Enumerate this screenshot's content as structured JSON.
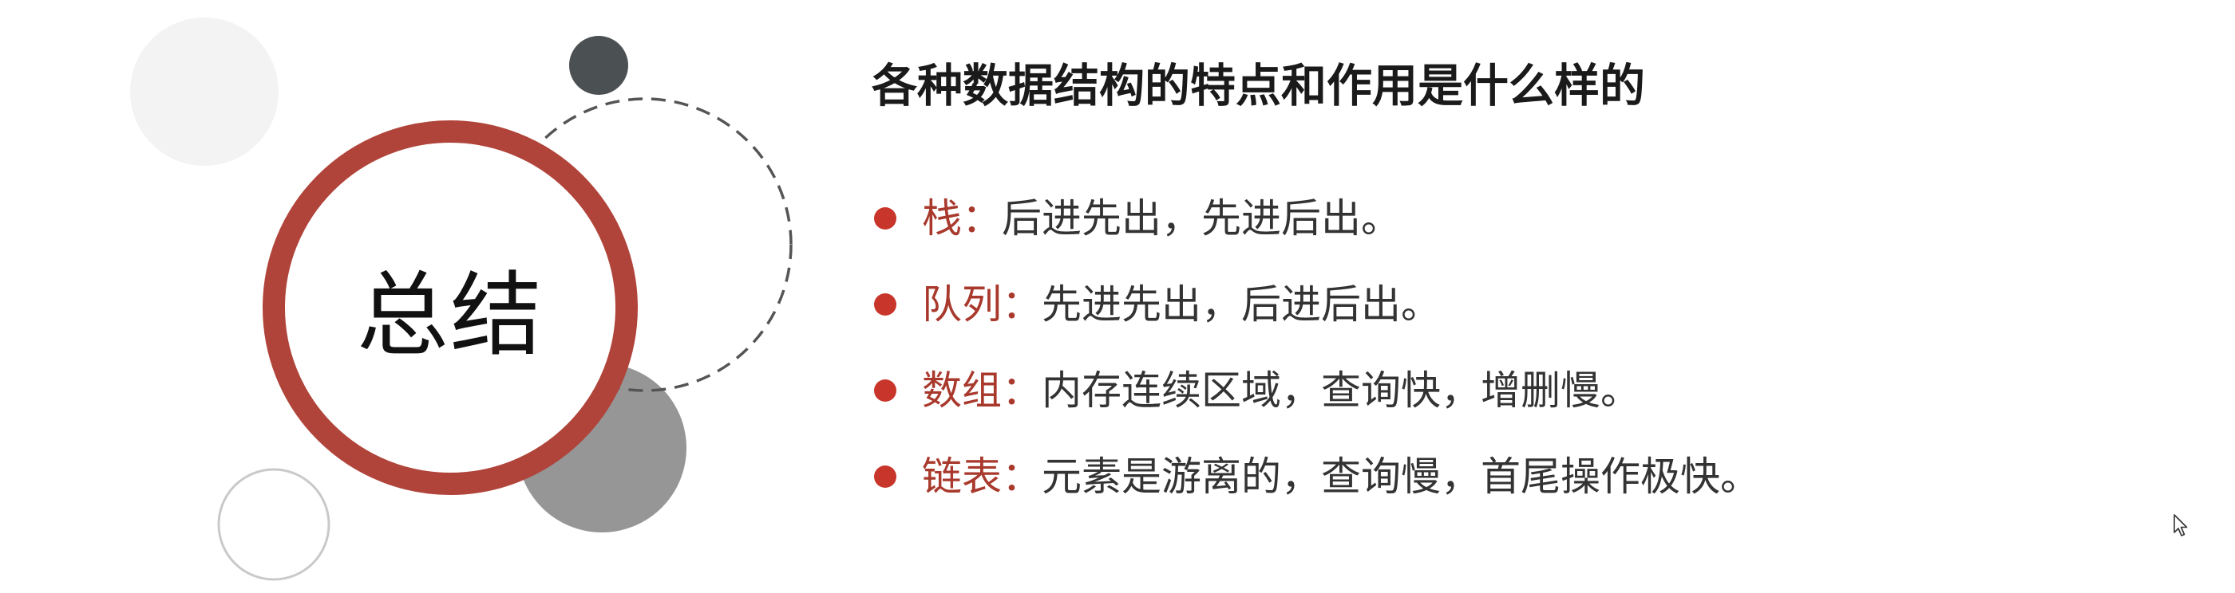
{
  "slide": {
    "summary_label": "总结",
    "title": "各种数据结构的特点和作用是什么样的",
    "points": [
      {
        "label": "栈：",
        "description": "后进先出，先进后出。"
      },
      {
        "label": "队列：",
        "description": "先进先出，后进后出。"
      },
      {
        "label": "数组：",
        "description": "内存连续区域，查询快，增删慢。"
      },
      {
        "label": "链表：",
        "description": "元素是游离的，查询慢，首尾操作极快。"
      }
    ]
  },
  "colors": {
    "ring": "#b0443a",
    "label": "#a8392c",
    "bullet_dot": "#c8352b",
    "body_text": "#333333",
    "title_text": "#1a1a1a",
    "summary_text": "#111111",
    "light_circle": "#f3f3f3",
    "dark_circle": "#4b5052",
    "gray_circle": "#969696",
    "dashed_stroke": "#555555",
    "outline_stroke": "#c9c9c9"
  },
  "icons": {
    "pointer": "cursor-icon"
  }
}
